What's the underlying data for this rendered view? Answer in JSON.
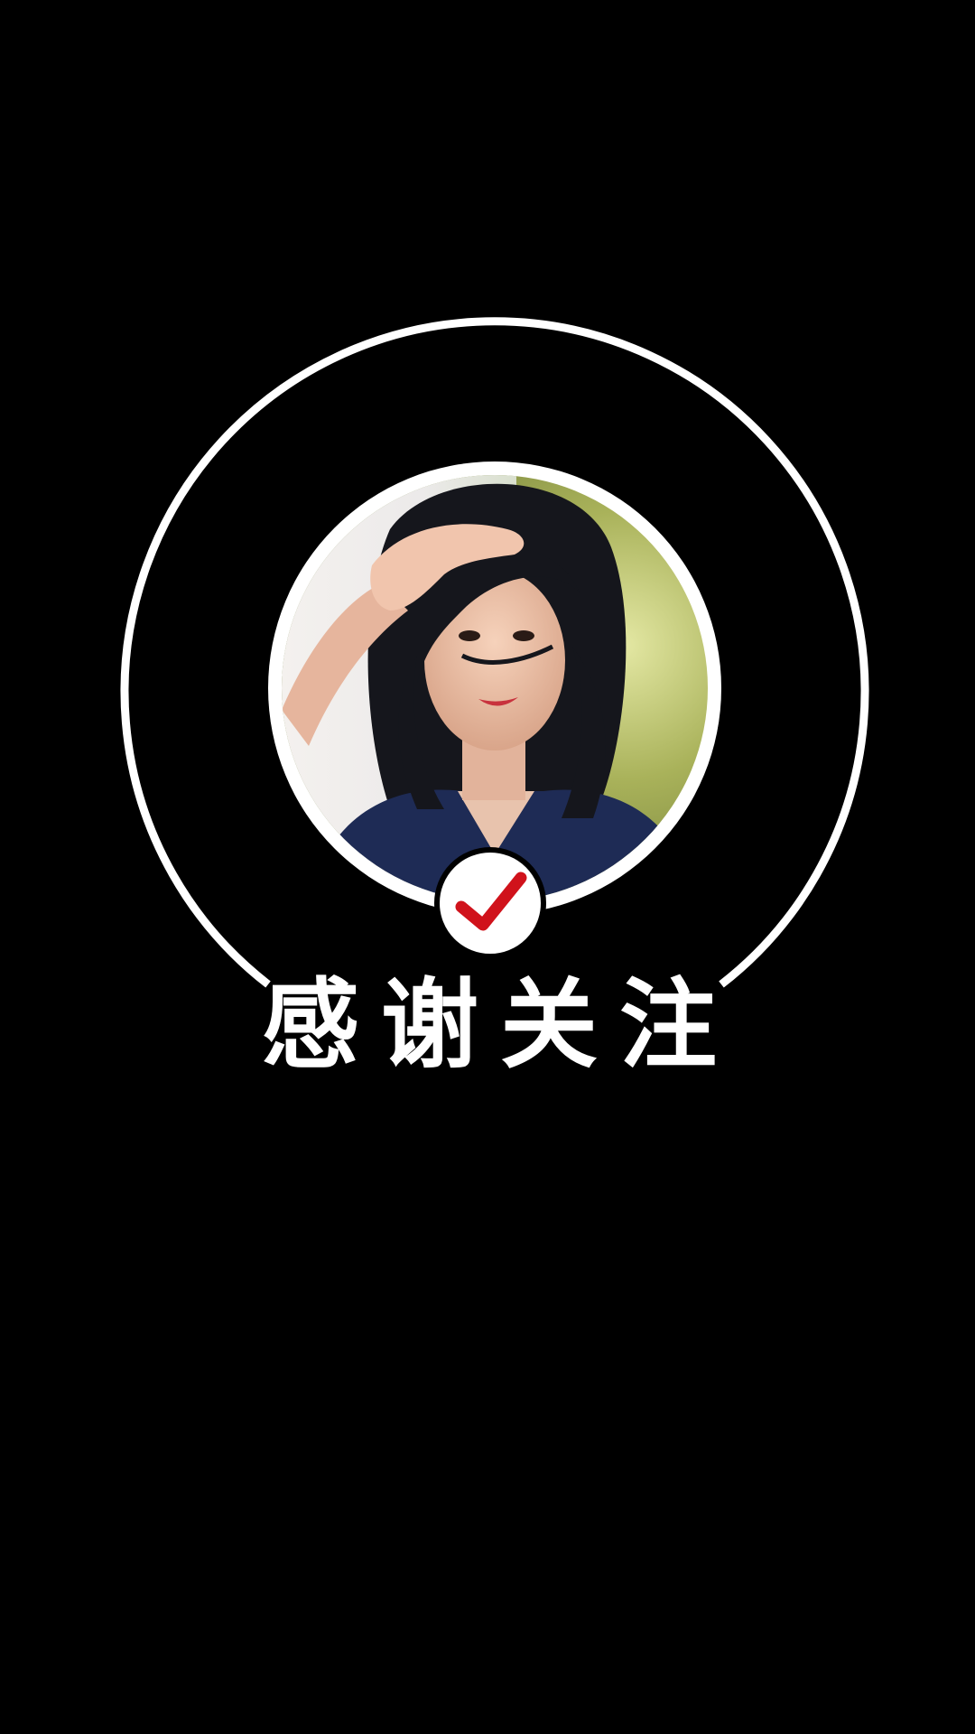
{
  "thanks_text": "感谢关注",
  "icons": {
    "check": "check-icon",
    "avatar": "avatar-photo"
  },
  "colors": {
    "background": "#000000",
    "ring": "#ffffff",
    "text": "#ffffff",
    "check": "#d0121b",
    "badge": "#ffffff"
  }
}
